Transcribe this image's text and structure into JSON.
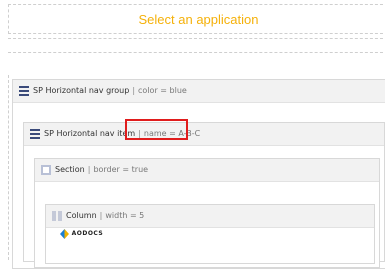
{
  "app_select": {
    "title": "Select an application"
  },
  "nav_group": {
    "name": "SP Horizontal nav group",
    "property": "color = blue"
  },
  "nav_item": {
    "name": "SP Horizontal nav item",
    "property": "name = A-B-C"
  },
  "section": {
    "name": "Section",
    "property": "border = true"
  },
  "column": {
    "name": "Column",
    "property": "width = 5"
  },
  "logo": {
    "text": "AODOCS"
  },
  "colors": {
    "title": "#f5b10a",
    "highlight": "#e01c1c",
    "group_icon": "#3a4a7a"
  },
  "icons": {
    "group": "stack-icon",
    "item": "stack-icon",
    "section": "section-icon",
    "column": "column-icon",
    "logo": "aodocs-logo-icon"
  }
}
